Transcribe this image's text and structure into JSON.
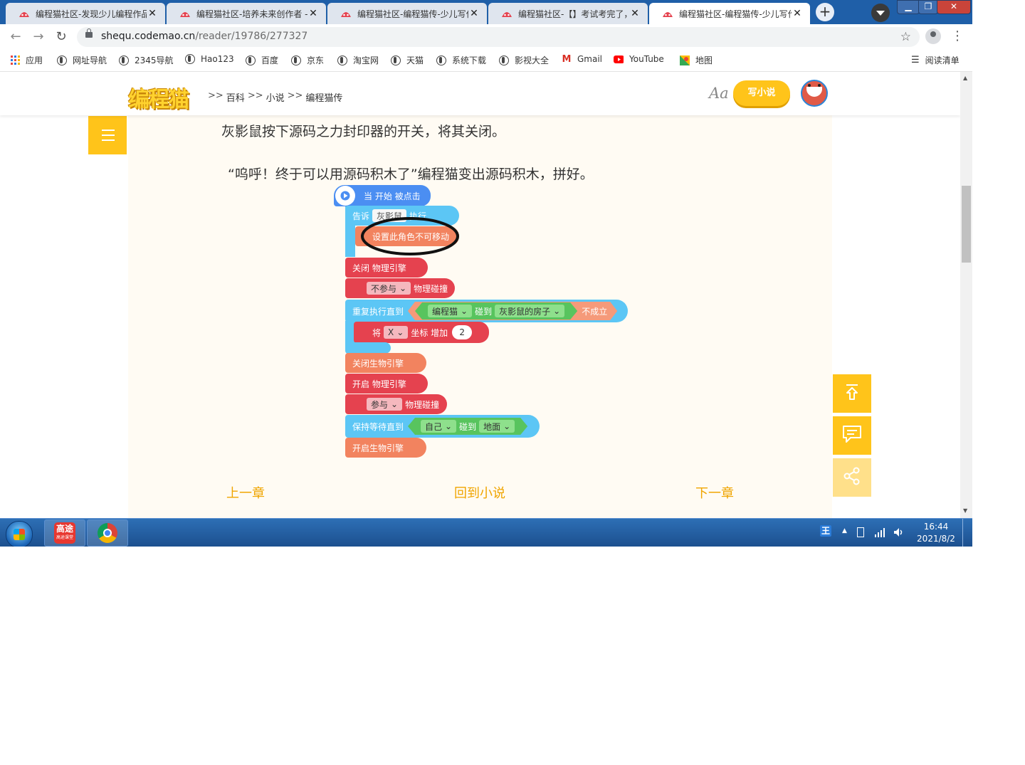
{
  "browser": {
    "tabs": [
      {
        "title": "编程猫社区-发现少儿编程作品"
      },
      {
        "title": "编程猫社区-培养未来创作者 -"
      },
      {
        "title": "编程猫社区-编程猫传-少儿写作"
      },
      {
        "title": "编程猫社区-【】考试考完了，"
      },
      {
        "title": "编程猫社区-编程猫传-少儿写作",
        "active": true
      }
    ],
    "new_tab": "+",
    "url_host": "shequ.codemao.cn",
    "url_path": "/reader/19786/277327"
  },
  "bookmarks": {
    "items": [
      {
        "label": "应用",
        "icon": "apps-grid-icon"
      },
      {
        "label": "网址导航",
        "icon": "globe-icon"
      },
      {
        "label": "2345导航",
        "icon": "globe-icon"
      },
      {
        "label": "Hao123",
        "icon": "globe-icon"
      },
      {
        "label": "百度",
        "icon": "globe-icon"
      },
      {
        "label": "京东",
        "icon": "globe-icon"
      },
      {
        "label": "淘宝网",
        "icon": "globe-icon"
      },
      {
        "label": "天猫",
        "icon": "globe-icon"
      },
      {
        "label": "系统下载",
        "icon": "globe-icon"
      },
      {
        "label": "影视大全",
        "icon": "globe-icon"
      },
      {
        "label": "Gmail",
        "icon": "gmail-icon"
      },
      {
        "label": "YouTube",
        "icon": "youtube-icon"
      },
      {
        "label": "地图",
        "icon": "maps-icon"
      }
    ],
    "reading_list": "阅读清单"
  },
  "site": {
    "logo": "编程猫",
    "breadcrumbs": [
      ">>",
      "百科",
      ">>",
      "小说",
      ">>",
      "编程猫传"
    ],
    "font_toggle": "Aa",
    "write_button": "写小说"
  },
  "article": {
    "para1": "灰影鼠按下源码之力封印器的开关，将其关闭。",
    "para2": "“呜呼！终于可以用源码积木了”编程猫变出源码积木，拼好。"
  },
  "code_blocks": {
    "hat": "当 开始 被点击",
    "tell_prefix": "告诉",
    "tell_target": "灰影鼠",
    "tell_suffix": "执行",
    "set_immovable": "设置此角色不可移动",
    "close_physics": "关闭 物理引擎",
    "no_collide_opt": "不参与",
    "collide_label": "物理碰撞",
    "repeat_until": "重复执行直到",
    "cat_opt": "编程猫",
    "touch": "碰到",
    "house_opt": "灰影鼠的房子",
    "not_true": "不成立",
    "change_prefix": "将",
    "axis_opt": "X",
    "coord_inc": "坐标 增加",
    "inc_value": "2",
    "close_bio": "关闭生物引擎",
    "open_physics": "开启 物理引擎",
    "join_opt": "参与",
    "collide_label2": "物理碰撞",
    "wait_until": "保持等待直到",
    "self_opt": "自己",
    "touch2": "碰到",
    "ground_opt": "地面",
    "open_bio": "开启生物引擎"
  },
  "chapter_nav": {
    "prev": "上一章",
    "back": "回到小说",
    "next": "下一章"
  },
  "taskbar": {
    "app1": "高途",
    "app1_sub": "高途课堂",
    "time": "16:44",
    "date": "2021/8/2"
  }
}
